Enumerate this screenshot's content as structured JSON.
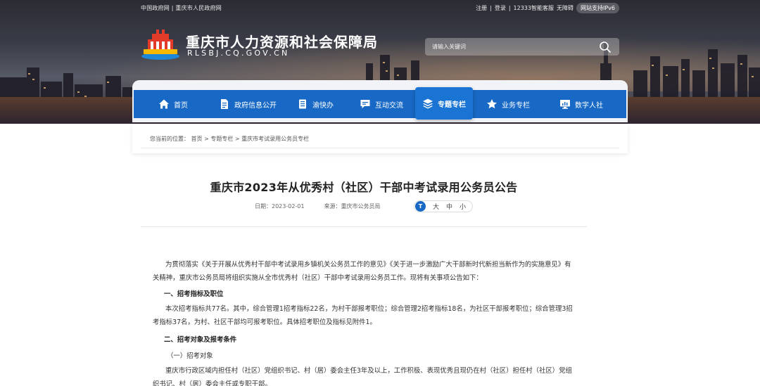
{
  "topbar": {
    "left_links": [
      "中国政府网",
      "重庆市人民政府网"
    ],
    "separator": "|",
    "right_links": [
      "注册",
      "登录",
      "12333智能客服",
      "无障碍"
    ],
    "ipv6": "网站支持IPv6"
  },
  "site": {
    "title": "重庆市人力资源和社会保障局",
    "domain": "RLSBJ.CQ.GOV.CN"
  },
  "search": {
    "placeholder": "请输入关键词"
  },
  "nav": {
    "items": [
      {
        "label": "首页",
        "icon": "home-icon"
      },
      {
        "label": "政府信息公开",
        "icon": "document-icon"
      },
      {
        "label": "渝快办",
        "icon": "book-icon"
      },
      {
        "label": "互动交流",
        "icon": "chat-icon"
      },
      {
        "label": "专题专栏",
        "icon": "layers-icon",
        "active": true
      },
      {
        "label": "业务专栏",
        "icon": "star-icon"
      },
      {
        "label": "数字人社",
        "icon": "monitor-icon"
      }
    ]
  },
  "breadcrumb": {
    "prefix": "您当前的位置：",
    "items": [
      "首页",
      "专题专栏",
      "重庆市考试录用公务员专栏"
    ],
    "separator": ">"
  },
  "article": {
    "title": "重庆市2023年从优秀村（社区）干部中考试录用公务员公告",
    "date_label": "日期：2023-02-01",
    "source_label": "来源：重庆市公务员局",
    "font_sizes": [
      "大",
      "中",
      "小"
    ],
    "font_badge": "T",
    "paragraphs": [
      "为贯彻落实《关于开展从优秀村干部中考试录用乡镇机关公务员工作的意见》《关于进一步激励广大干部新时代新担当新作为的实施意见》有关精神，重庆市公务员局将组织实施从全市优秀村（社区）干部中考试录用公务员工作。现将有关事项公告如下：",
      "一、招考指标及职位",
      "本次招考指标共77名。其中，综合管理1招考指标22名，为村干部报考职位；综合管理2招考指标18名，为社区干部报考职位；综合管理3招考指标37名，为村、社区干部均可报考职位。具体招考职位及指标见附件1。",
      "二、招考对象及报考条件",
      "（一）招考对象",
      "重庆市行政区域内担任村（社区）党组织书记、村（居）委会主任3年及以上，工作积极、表现优秀且现仍在村（社区）担任村（社区）党组织书记、村（居）委会主任或专职干部。"
    ]
  },
  "colors": {
    "nav_blue": "#1769c5",
    "text": "#333333"
  }
}
